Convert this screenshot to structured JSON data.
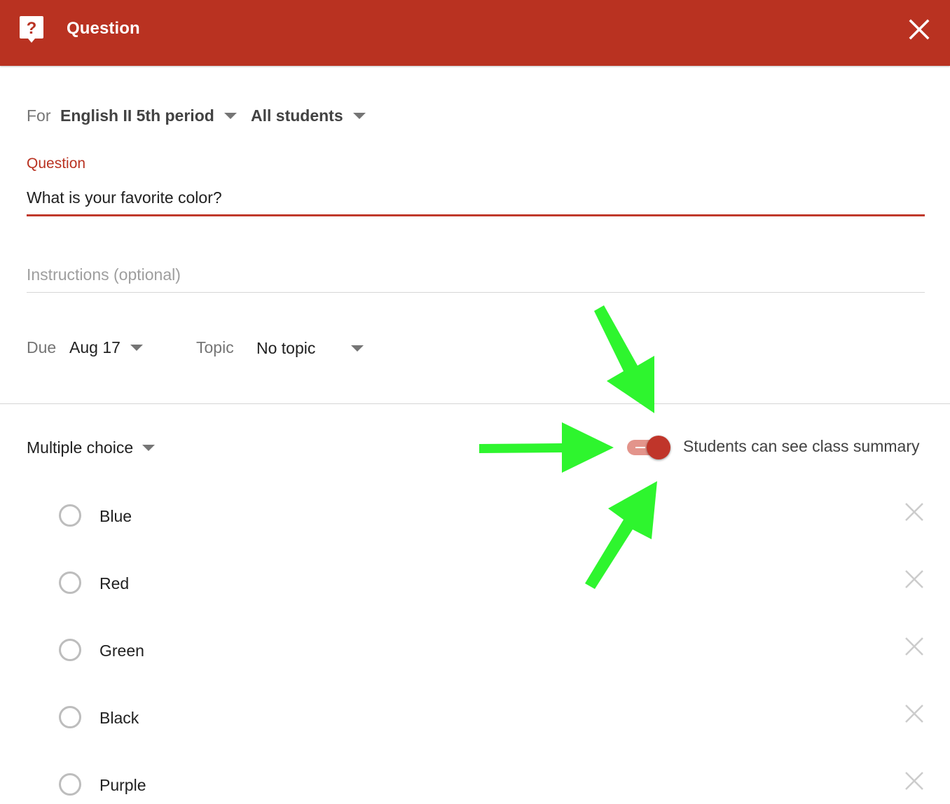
{
  "header": {
    "title": "Question",
    "background_color": "#b93221",
    "icon": "question-bubble-icon",
    "close_icon": "close-icon"
  },
  "assign": {
    "for_label": "For",
    "class_name": "English II 5th period",
    "audience": "All students"
  },
  "question": {
    "label": "Question",
    "value": "What is your favorite color?",
    "accent_color": "#c0392b"
  },
  "instructions": {
    "placeholder": "Instructions (optional)",
    "value": ""
  },
  "due": {
    "label": "Due",
    "value": "Aug 17"
  },
  "topic": {
    "label": "Topic",
    "value": "No topic"
  },
  "question_type": {
    "value": "Multiple choice"
  },
  "class_summary_toggle": {
    "label": "Students can see class summary",
    "on": true
  },
  "choices": [
    {
      "label": "Blue"
    },
    {
      "label": "Red"
    },
    {
      "label": "Green"
    },
    {
      "label": "Black"
    },
    {
      "label": "Purple"
    }
  ],
  "annotation": {
    "arrow_color": "#2ef52e",
    "arrow_count": 3
  }
}
